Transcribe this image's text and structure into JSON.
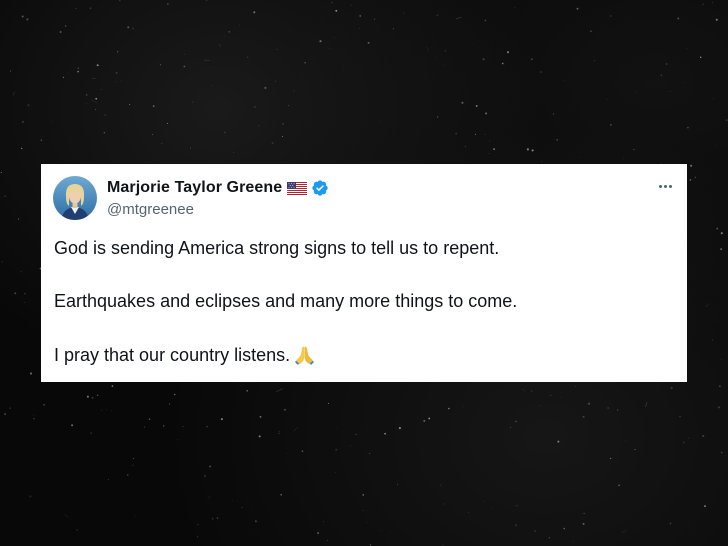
{
  "tweet": {
    "author": {
      "display_name": "Marjorie Taylor Greene",
      "handle": "@mtgreenee",
      "flag_icon": "us-flag-icon",
      "verified_icon": "verified-badge-icon",
      "verified_color": "#1d9bf0"
    },
    "more_icon": "more-options-icon",
    "lines": [
      "God is sending America strong signs to tell us to repent.",
      "Earthquakes and eclipses and many more things to come.",
      "I pray that our country listens."
    ],
    "trailing_emoji_icon": "folded-hands-icon"
  },
  "colors": {
    "background": "#080808",
    "card": "#ffffff",
    "text_primary": "#0f1419",
    "text_secondary": "#536471"
  }
}
